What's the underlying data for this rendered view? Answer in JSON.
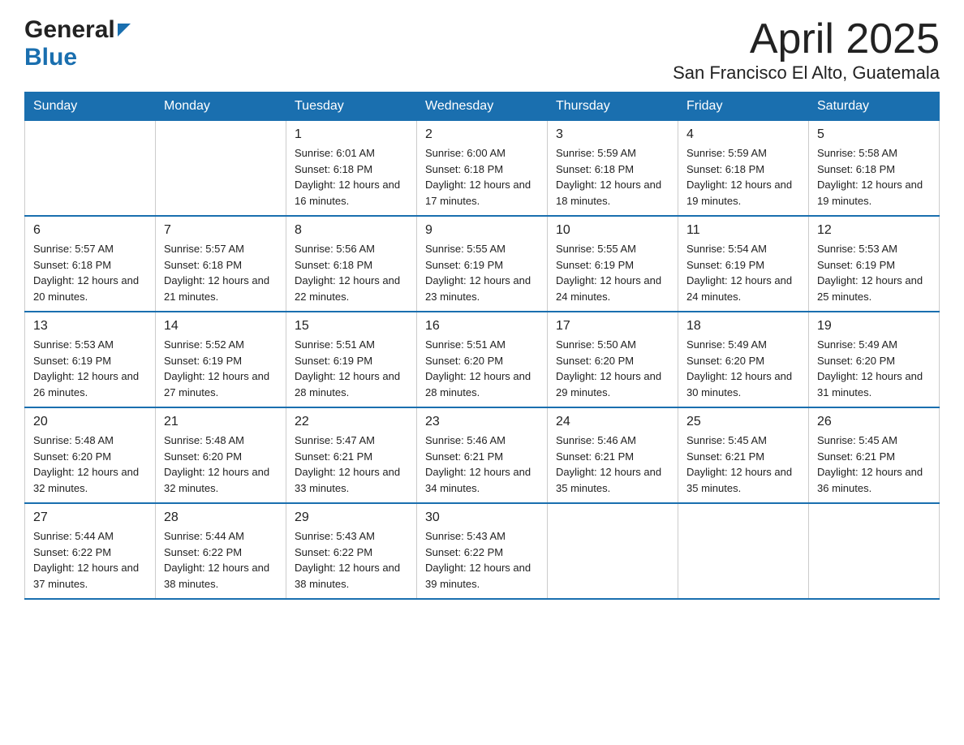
{
  "logo": {
    "general": "General",
    "blue": "Blue",
    "arrow": "▶"
  },
  "title": "April 2025",
  "subtitle": "San Francisco El Alto, Guatemala",
  "calendar": {
    "headers": [
      "Sunday",
      "Monday",
      "Tuesday",
      "Wednesday",
      "Thursday",
      "Friday",
      "Saturday"
    ],
    "weeks": [
      [
        {
          "day": "",
          "sunrise": "",
          "sunset": "",
          "daylight": ""
        },
        {
          "day": "",
          "sunrise": "",
          "sunset": "",
          "daylight": ""
        },
        {
          "day": "1",
          "sunrise": "Sunrise: 6:01 AM",
          "sunset": "Sunset: 6:18 PM",
          "daylight": "Daylight: 12 hours and 16 minutes."
        },
        {
          "day": "2",
          "sunrise": "Sunrise: 6:00 AM",
          "sunset": "Sunset: 6:18 PM",
          "daylight": "Daylight: 12 hours and 17 minutes."
        },
        {
          "day": "3",
          "sunrise": "Sunrise: 5:59 AM",
          "sunset": "Sunset: 6:18 PM",
          "daylight": "Daylight: 12 hours and 18 minutes."
        },
        {
          "day": "4",
          "sunrise": "Sunrise: 5:59 AM",
          "sunset": "Sunset: 6:18 PM",
          "daylight": "Daylight: 12 hours and 19 minutes."
        },
        {
          "day": "5",
          "sunrise": "Sunrise: 5:58 AM",
          "sunset": "Sunset: 6:18 PM",
          "daylight": "Daylight: 12 hours and 19 minutes."
        }
      ],
      [
        {
          "day": "6",
          "sunrise": "Sunrise: 5:57 AM",
          "sunset": "Sunset: 6:18 PM",
          "daylight": "Daylight: 12 hours and 20 minutes."
        },
        {
          "day": "7",
          "sunrise": "Sunrise: 5:57 AM",
          "sunset": "Sunset: 6:18 PM",
          "daylight": "Daylight: 12 hours and 21 minutes."
        },
        {
          "day": "8",
          "sunrise": "Sunrise: 5:56 AM",
          "sunset": "Sunset: 6:18 PM",
          "daylight": "Daylight: 12 hours and 22 minutes."
        },
        {
          "day": "9",
          "sunrise": "Sunrise: 5:55 AM",
          "sunset": "Sunset: 6:19 PM",
          "daylight": "Daylight: 12 hours and 23 minutes."
        },
        {
          "day": "10",
          "sunrise": "Sunrise: 5:55 AM",
          "sunset": "Sunset: 6:19 PM",
          "daylight": "Daylight: 12 hours and 24 minutes."
        },
        {
          "day": "11",
          "sunrise": "Sunrise: 5:54 AM",
          "sunset": "Sunset: 6:19 PM",
          "daylight": "Daylight: 12 hours and 24 minutes."
        },
        {
          "day": "12",
          "sunrise": "Sunrise: 5:53 AM",
          "sunset": "Sunset: 6:19 PM",
          "daylight": "Daylight: 12 hours and 25 minutes."
        }
      ],
      [
        {
          "day": "13",
          "sunrise": "Sunrise: 5:53 AM",
          "sunset": "Sunset: 6:19 PM",
          "daylight": "Daylight: 12 hours and 26 minutes."
        },
        {
          "day": "14",
          "sunrise": "Sunrise: 5:52 AM",
          "sunset": "Sunset: 6:19 PM",
          "daylight": "Daylight: 12 hours and 27 minutes."
        },
        {
          "day": "15",
          "sunrise": "Sunrise: 5:51 AM",
          "sunset": "Sunset: 6:19 PM",
          "daylight": "Daylight: 12 hours and 28 minutes."
        },
        {
          "day": "16",
          "sunrise": "Sunrise: 5:51 AM",
          "sunset": "Sunset: 6:20 PM",
          "daylight": "Daylight: 12 hours and 28 minutes."
        },
        {
          "day": "17",
          "sunrise": "Sunrise: 5:50 AM",
          "sunset": "Sunset: 6:20 PM",
          "daylight": "Daylight: 12 hours and 29 minutes."
        },
        {
          "day": "18",
          "sunrise": "Sunrise: 5:49 AM",
          "sunset": "Sunset: 6:20 PM",
          "daylight": "Daylight: 12 hours and 30 minutes."
        },
        {
          "day": "19",
          "sunrise": "Sunrise: 5:49 AM",
          "sunset": "Sunset: 6:20 PM",
          "daylight": "Daylight: 12 hours and 31 minutes."
        }
      ],
      [
        {
          "day": "20",
          "sunrise": "Sunrise: 5:48 AM",
          "sunset": "Sunset: 6:20 PM",
          "daylight": "Daylight: 12 hours and 32 minutes."
        },
        {
          "day": "21",
          "sunrise": "Sunrise: 5:48 AM",
          "sunset": "Sunset: 6:20 PM",
          "daylight": "Daylight: 12 hours and 32 minutes."
        },
        {
          "day": "22",
          "sunrise": "Sunrise: 5:47 AM",
          "sunset": "Sunset: 6:21 PM",
          "daylight": "Daylight: 12 hours and 33 minutes."
        },
        {
          "day": "23",
          "sunrise": "Sunrise: 5:46 AM",
          "sunset": "Sunset: 6:21 PM",
          "daylight": "Daylight: 12 hours and 34 minutes."
        },
        {
          "day": "24",
          "sunrise": "Sunrise: 5:46 AM",
          "sunset": "Sunset: 6:21 PM",
          "daylight": "Daylight: 12 hours and 35 minutes."
        },
        {
          "day": "25",
          "sunrise": "Sunrise: 5:45 AM",
          "sunset": "Sunset: 6:21 PM",
          "daylight": "Daylight: 12 hours and 35 minutes."
        },
        {
          "day": "26",
          "sunrise": "Sunrise: 5:45 AM",
          "sunset": "Sunset: 6:21 PM",
          "daylight": "Daylight: 12 hours and 36 minutes."
        }
      ],
      [
        {
          "day": "27",
          "sunrise": "Sunrise: 5:44 AM",
          "sunset": "Sunset: 6:22 PM",
          "daylight": "Daylight: 12 hours and 37 minutes."
        },
        {
          "day": "28",
          "sunrise": "Sunrise: 5:44 AM",
          "sunset": "Sunset: 6:22 PM",
          "daylight": "Daylight: 12 hours and 38 minutes."
        },
        {
          "day": "29",
          "sunrise": "Sunrise: 5:43 AM",
          "sunset": "Sunset: 6:22 PM",
          "daylight": "Daylight: 12 hours and 38 minutes."
        },
        {
          "day": "30",
          "sunrise": "Sunrise: 5:43 AM",
          "sunset": "Sunset: 6:22 PM",
          "daylight": "Daylight: 12 hours and 39 minutes."
        },
        {
          "day": "",
          "sunrise": "",
          "sunset": "",
          "daylight": ""
        },
        {
          "day": "",
          "sunrise": "",
          "sunset": "",
          "daylight": ""
        },
        {
          "day": "",
          "sunrise": "",
          "sunset": "",
          "daylight": ""
        }
      ]
    ]
  }
}
